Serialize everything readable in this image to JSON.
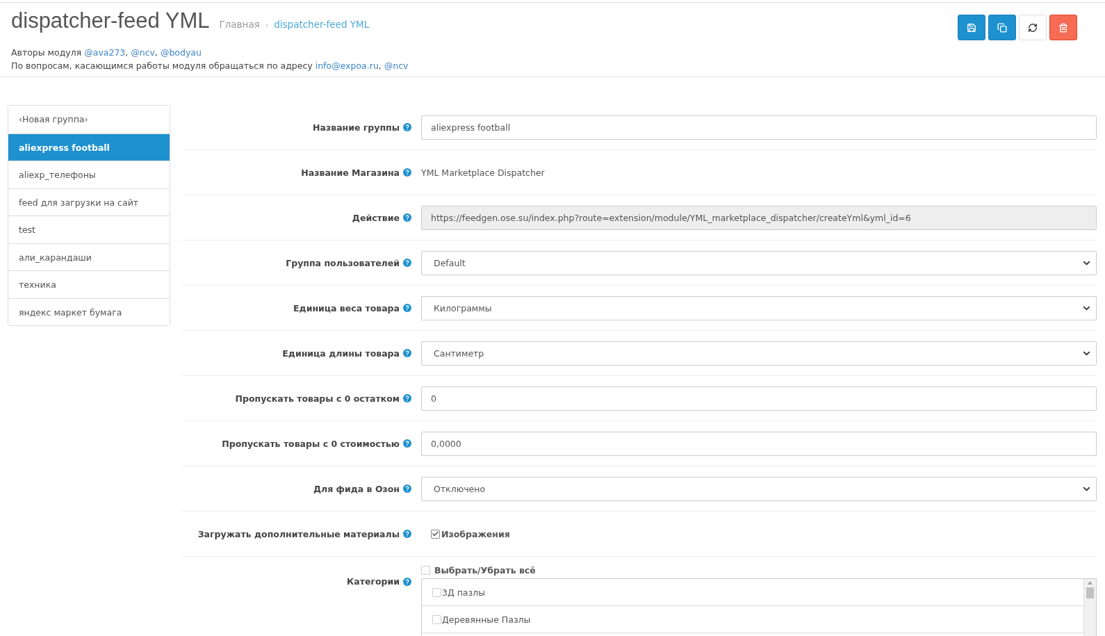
{
  "header": {
    "title": "dispatcher-feed YML",
    "breadcrumbs": [
      {
        "label": "Главная"
      },
      {
        "label": "dispatcher-feed YML"
      }
    ],
    "breadcrumb_separator": "›",
    "authors": {
      "text": "Авторы модуля",
      "separator": ", ",
      "links": [
        "@ava273",
        "@ncv",
        "@bodyau"
      ]
    },
    "contact": {
      "text": "По вопросам, касающимся работы модуля обращаться по адресу",
      "separator": ", ",
      "links": [
        "info@expoa.ru",
        "@ncv"
      ]
    },
    "buttons": [
      {
        "kind": "save"
      },
      {
        "kind": "copy"
      },
      {
        "kind": "refresh"
      },
      {
        "kind": "delete"
      }
    ]
  },
  "groups": [
    {
      "label": "‹Новая группа›",
      "selected": false
    },
    {
      "label": "aliexpress football",
      "selected": true
    },
    {
      "label": "aliexp_телефоны",
      "selected": false
    },
    {
      "label": "feed для загрузки на сайт",
      "selected": false
    },
    {
      "label": "test",
      "selected": false
    },
    {
      "label": "али_карандаши",
      "selected": false
    },
    {
      "label": "техника",
      "selected": false
    },
    {
      "label": "яндекс маркет бумага",
      "selected": false
    }
  ],
  "form": [
    {
      "kind": "text",
      "label": "Название группы",
      "value": "aliexpress football"
    },
    {
      "kind": "static",
      "label": "Название Магазина",
      "value": "YML Marketplace Dispatcher"
    },
    {
      "kind": "readonly",
      "label": "Действие",
      "value": "https://feedgen.ose.su/index.php?route=extension/module/YML_marketplace_dispatcher/createYml&yml_id=6"
    },
    {
      "kind": "select",
      "label": "Группа пользователей",
      "value": "Default"
    },
    {
      "kind": "select",
      "label": "Единица веса товара",
      "value": "Килограммы"
    },
    {
      "kind": "select",
      "label": "Единица длины товара",
      "value": "Сантиметр"
    },
    {
      "kind": "text",
      "label": "Пропускать товары с 0 остатком",
      "value": "0"
    },
    {
      "kind": "text",
      "label": "Пропускать товары с 0 стоимостью",
      "value": "0,0000"
    },
    {
      "kind": "select",
      "label": "Для фида в Озон",
      "value": "Отключено"
    },
    {
      "kind": "checkboxes",
      "label": "Загружать дополнительные материалы",
      "options": [
        {
          "label": "Изображения",
          "checked": true
        }
      ]
    },
    {
      "kind": "categories",
      "label": "Категории",
      "select_all": {
        "label": "Выбрать/Убрать всё",
        "checked": false
      },
      "options": [
        {
          "label": "3Д пазлы",
          "checked": false
        },
        {
          "label": "Деревянные Пазлы",
          "checked": false
        }
      ]
    }
  ]
}
